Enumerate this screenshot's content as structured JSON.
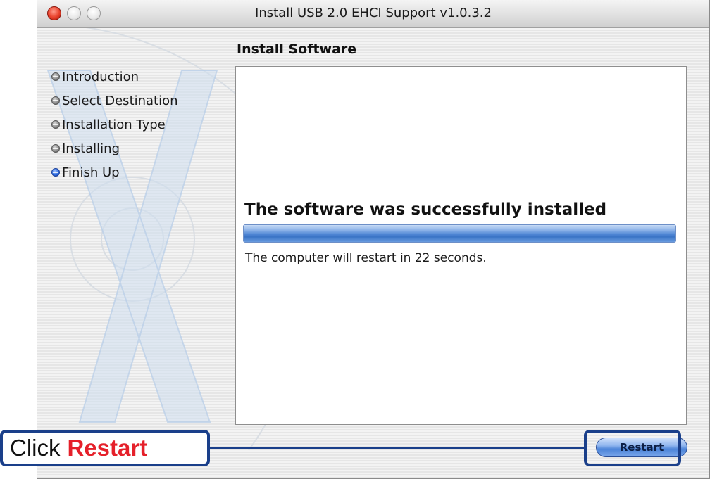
{
  "window": {
    "title": "Install USB 2.0 EHCI Support v1.0.3.2"
  },
  "section_title": "Install Software",
  "steps": [
    {
      "label": "Introduction",
      "active": false
    },
    {
      "label": "Select Destination",
      "active": false
    },
    {
      "label": "Installation Type",
      "active": false
    },
    {
      "label": "Installing",
      "active": false
    },
    {
      "label": "Finish Up",
      "active": true
    }
  ],
  "content": {
    "heading": "The software was successfully installed",
    "progress_percent": 100,
    "message": "The computer will restart in 22 seconds."
  },
  "buttons": {
    "restart_label": "Restart"
  },
  "callout": {
    "click_text": "Click",
    "action_text": "Restart"
  },
  "icons": {
    "close": "close-icon",
    "minimize": "minimize-icon",
    "zoom": "zoom-icon",
    "step_bullet": "step-bullet-icon",
    "watermark": "mac-os-x-logo"
  },
  "colors": {
    "accent": "#1a3f8a",
    "callout_action": "#e5202a",
    "progress": "#4f86d4"
  }
}
